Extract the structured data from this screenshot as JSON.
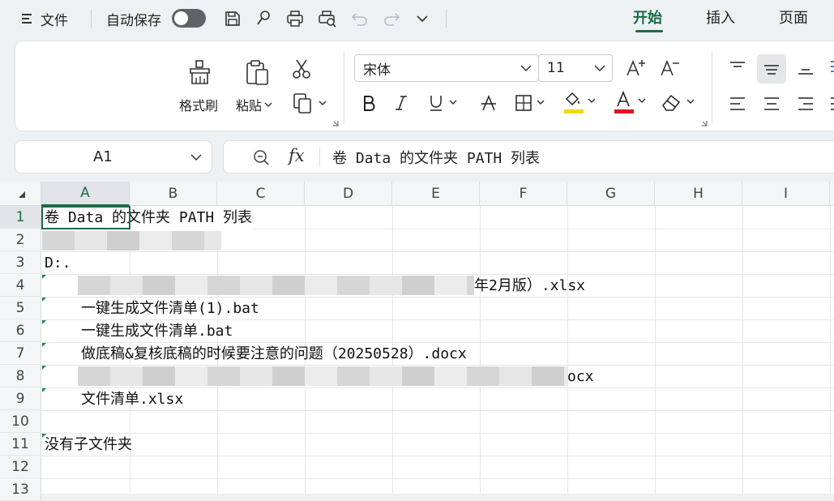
{
  "titlebar": {
    "menu_label": "文件",
    "autosave_label": "自动保存",
    "tabs": [
      "开始",
      "插入",
      "页面"
    ]
  },
  "ribbon": {
    "format_painter_label": "格式刷",
    "paste_label": "粘贴",
    "font_name": "宋体",
    "font_size": "11"
  },
  "formula": {
    "cell_ref": "A1",
    "fx_label": "fx",
    "content": "卷 Data 的文件夹 PATH 列表"
  },
  "grid": {
    "columns": [
      "A",
      "B",
      "C",
      "D",
      "E",
      "F",
      "G",
      "H",
      "I"
    ],
    "rows": [
      "1",
      "2",
      "3",
      "4",
      "5",
      "6",
      "7",
      "8",
      "9",
      "10",
      "11",
      "12",
      "13"
    ],
    "cells": {
      "r1": "卷 Data 的文件夹 PATH 列表",
      "r3": "D:.",
      "r4_tail": "年2月版）.xlsx",
      "r5": "一键生成文件清单(1).bat",
      "r6": "一键生成文件清单.bat",
      "r7": "做底稿&复核底稿的时候要注意的问题（20250528）.docx",
      "r8_tail": "ocx",
      "r9": "文件清单.xlsx",
      "r11": "没有子文件夹"
    }
  },
  "colors": {
    "accent": "#1c6b45",
    "font_color_bar": "#d9161c",
    "highlight_bar": "#f5d60b"
  }
}
